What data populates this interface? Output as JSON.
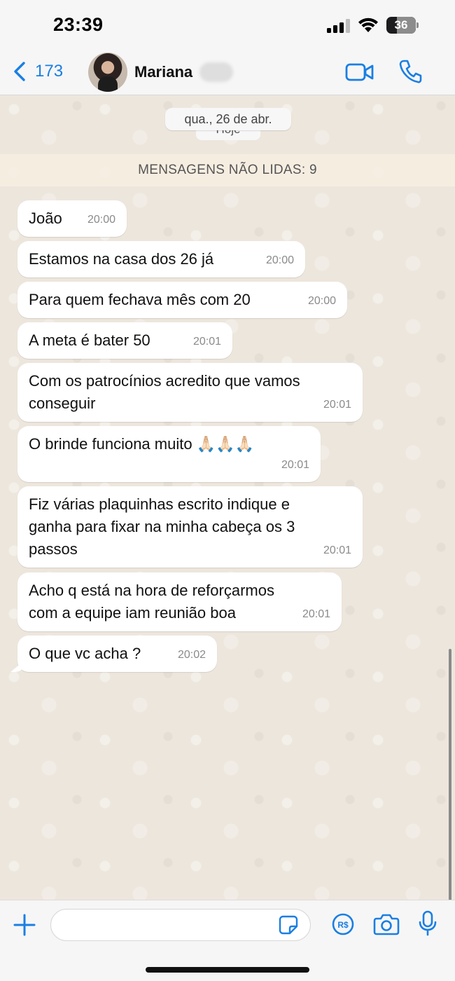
{
  "status_bar": {
    "time": "23:39",
    "battery_level": "36",
    "icons": [
      "signal-icon",
      "wifi-icon",
      "battery-icon"
    ]
  },
  "header": {
    "back_count": "173",
    "contact_name": "Mariana",
    "icons": [
      "chevron-left-icon",
      "video-call-icon",
      "phone-icon"
    ]
  },
  "chat": {
    "date_label": "qua., 26 de abr.",
    "date_label_behind": "Hoje",
    "unread_banner": "MENSAGENS NÃO LIDAS: 9",
    "messages": [
      {
        "text": "João",
        "time": "20:00"
      },
      {
        "text": "Estamos na casa dos 26 já",
        "time": "20:00"
      },
      {
        "text": "Para quem fechava mês com 20",
        "time": "20:00"
      },
      {
        "text": "A meta é bater 50",
        "time": "20:01"
      },
      {
        "text": "Com os patrocínios acredito que vamos\nconseguir",
        "time": "20:01"
      },
      {
        "text": "O brinde funciona muito 🙏🏻🙏🏻🙏🏻",
        "time": "20:01"
      },
      {
        "text": "Fiz várias plaquinhas escrito indique e\nganha para fixar na minha cabeça os 3\npassos",
        "time": "20:01"
      },
      {
        "text": "Acho q está na hora de reforçarmos\ncom a equipe iam reunião boa",
        "time": "20:01"
      },
      {
        "text": "O que vc acha ?",
        "time": "20:02"
      }
    ]
  },
  "composer": {
    "input_value": "",
    "icons": [
      "plus-icon",
      "sticker-icon",
      "pix-payment-icon",
      "camera-icon",
      "microphone-icon"
    ]
  },
  "colors": {
    "accent": "#1a7fe3",
    "chat_background": "#ede6dd",
    "bubble": "#ffffff"
  }
}
